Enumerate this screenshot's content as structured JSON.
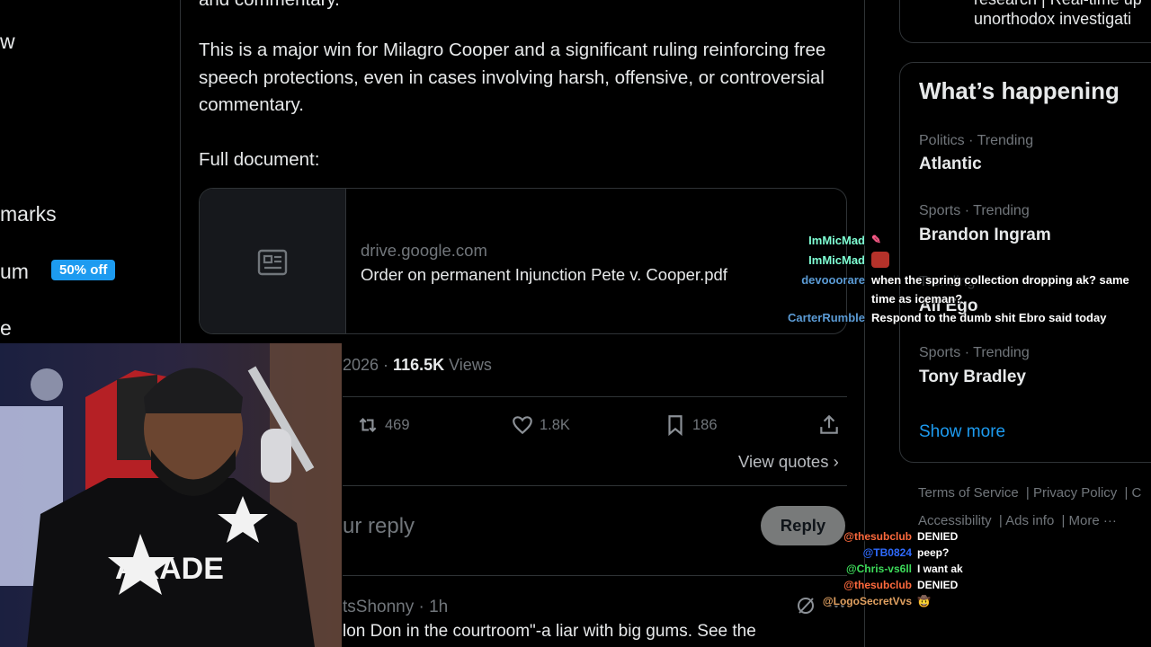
{
  "nav": {
    "item1": "w",
    "item2": "marks",
    "item3": "um",
    "item3_badge": "50% off",
    "item4": "e"
  },
  "post": {
    "text_top": "and commentary.",
    "paragraph": "This is a major win for Milagro Cooper and a significant ruling reinforcing free speech protections, even in cases involving harsh, offensive, or controversial commentary.",
    "full_doc_label": "Full document:",
    "link_card": {
      "domain": "drive.google.com",
      "title": "Order on permanent Injunction Pete v. Cooper.pdf",
      "thumb_icon": "article-icon"
    },
    "meta": {
      "date_fragment": "2026",
      "views_count": "116.5K",
      "views_label": "Views"
    },
    "actions": {
      "reposts": "469",
      "likes": "1.8K",
      "bookmarks": "186"
    },
    "view_quotes": "View quotes",
    "reply_placeholder": "ur reply",
    "reply_button": "Reply",
    "reply_author": "tsShonny · 1h",
    "reply_text": "lon Don in the courtroom\"-a liar with big gums. See the"
  },
  "sidebar": {
    "top_box_line1": "research | Real-time up",
    "top_box_line2": "unorthodox investigati",
    "happening_title": "What’s happening",
    "trends": [
      {
        "category": "Politics · Trending",
        "name": "Atlantic"
      },
      {
        "category": "Sports · Trending",
        "name": "Brandon Ingram"
      },
      {
        "category": "Trending",
        "name": "All Ego"
      },
      {
        "category": "Sports · Trending",
        "name": "Tony Bradley"
      }
    ],
    "show_more": "Show more",
    "footer": {
      "terms": "Terms of Service",
      "privacy": "Privacy Policy",
      "cut": "C",
      "accessibility": "Accessibility",
      "ads": "Ads info",
      "more": "More ···"
    }
  },
  "chat_upper": [
    {
      "user": "ImMicMad",
      "msg": "",
      "color": "#7fffd4"
    },
    {
      "user": "ImMicMad",
      "msg": "",
      "color": "#7fffd4"
    },
    {
      "user": "devooorare",
      "msg": "when the spring collection dropping ak? same",
      "msg2": "time as iceman?",
      "color": "#5b9bd5"
    },
    {
      "user": "CarterRumble",
      "msg": "Respond to the dumb shit Ebro said today",
      "color": "#5b9bd5"
    }
  ],
  "chat_lower": [
    {
      "user": "@thesubclub",
      "msg": "DENIED",
      "color": "#ff6a3d"
    },
    {
      "user": "@TB0824",
      "msg": "peep?",
      "color": "#2f6bff"
    },
    {
      "user": "@Chris-vs6ll",
      "msg": "I want ak",
      "color": "#3ddc5a"
    },
    {
      "user": "@thesubclub",
      "msg": "DENIED",
      "color": "#ff6a3d"
    },
    {
      "user": "@LogoSecretVvs",
      "msg": "🤠",
      "color": "#e0a060"
    }
  ],
  "colors": {
    "accent": "#1d9bf0",
    "border": "#2f3336",
    "muted": "#71767b"
  }
}
